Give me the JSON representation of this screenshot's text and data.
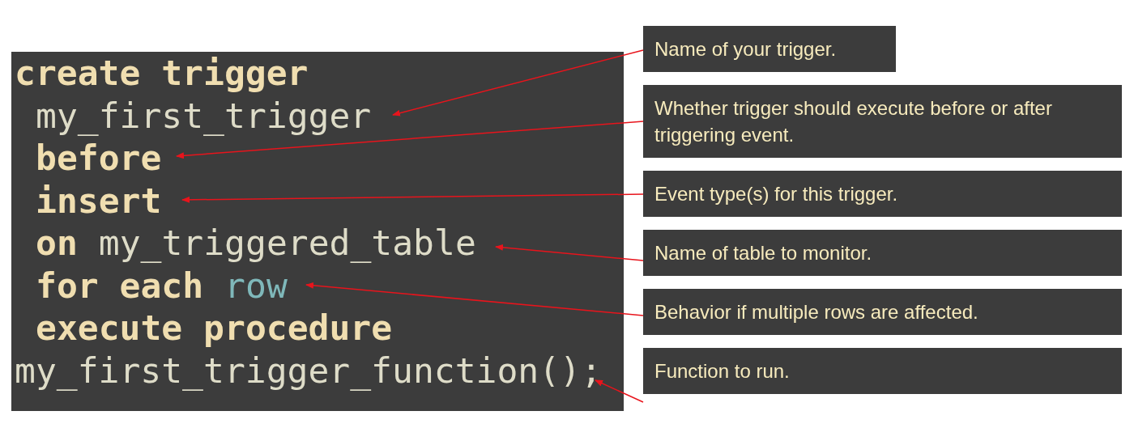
{
  "code_lines": [
    {
      "indented": false,
      "segments": [
        {
          "text": "create trigger",
          "kind": "keyword"
        }
      ]
    },
    {
      "indented": true,
      "segments": [
        {
          "text": "my_first_trigger",
          "kind": "identifier"
        }
      ]
    },
    {
      "indented": true,
      "segments": [
        {
          "text": "before",
          "kind": "keyword"
        }
      ]
    },
    {
      "indented": true,
      "segments": [
        {
          "text": "insert",
          "kind": "keyword"
        }
      ]
    },
    {
      "indented": true,
      "segments": [
        {
          "text": "on",
          "kind": "keyword"
        },
        {
          "text": "my_triggered_table",
          "kind": "identifier"
        }
      ]
    },
    {
      "indented": true,
      "segments": [
        {
          "text": "for each",
          "kind": "keyword"
        },
        {
          "text": "row",
          "kind": "type"
        }
      ]
    },
    {
      "indented": true,
      "segments": [
        {
          "text": "execute procedure",
          "kind": "keyword"
        }
      ]
    },
    {
      "indented": false,
      "segments": [
        {
          "text": "my_first_trigger_function();",
          "kind": "identifier"
        }
      ]
    }
  ],
  "annotations": [
    {
      "text": "Name of your trigger.",
      "wide": false
    },
    {
      "text": "Whether trigger should execute before or after triggering event.",
      "wide": true
    },
    {
      "text": "Event type(s) for this trigger.",
      "wide": true
    },
    {
      "text": "Name of table to monitor.",
      "wide": true
    },
    {
      "text": "Behavior if multiple rows are affected.",
      "wide": true
    },
    {
      "text": "Function to run.",
      "wide": true
    }
  ]
}
